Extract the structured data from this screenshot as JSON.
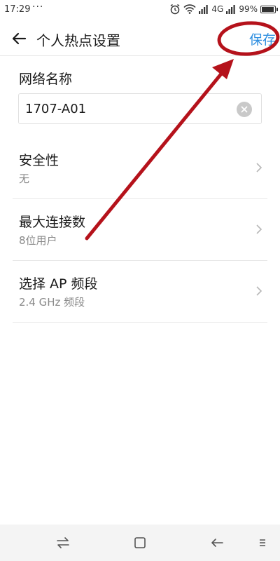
{
  "status_bar": {
    "time": "17:29",
    "dots": "···",
    "network": "4G",
    "battery_text": "99%",
    "battery_level": 0.99
  },
  "header": {
    "title": "个人热点设置",
    "save_label": "保存"
  },
  "network_name": {
    "label": "网络名称",
    "value": "1707-A01"
  },
  "settings": [
    {
      "title": "安全性",
      "value": "无"
    },
    {
      "title": "最大连接数",
      "value": "8位用户"
    },
    {
      "title": "选择 AP 频段",
      "value": "2.4 GHz 频段"
    }
  ],
  "colors": {
    "accent": "#2f8fe0",
    "annotation": "#b5121b"
  },
  "icons": {
    "back": "arrow-left-icon",
    "clear": "clear-icon",
    "chevron": "chevron-right-icon"
  }
}
